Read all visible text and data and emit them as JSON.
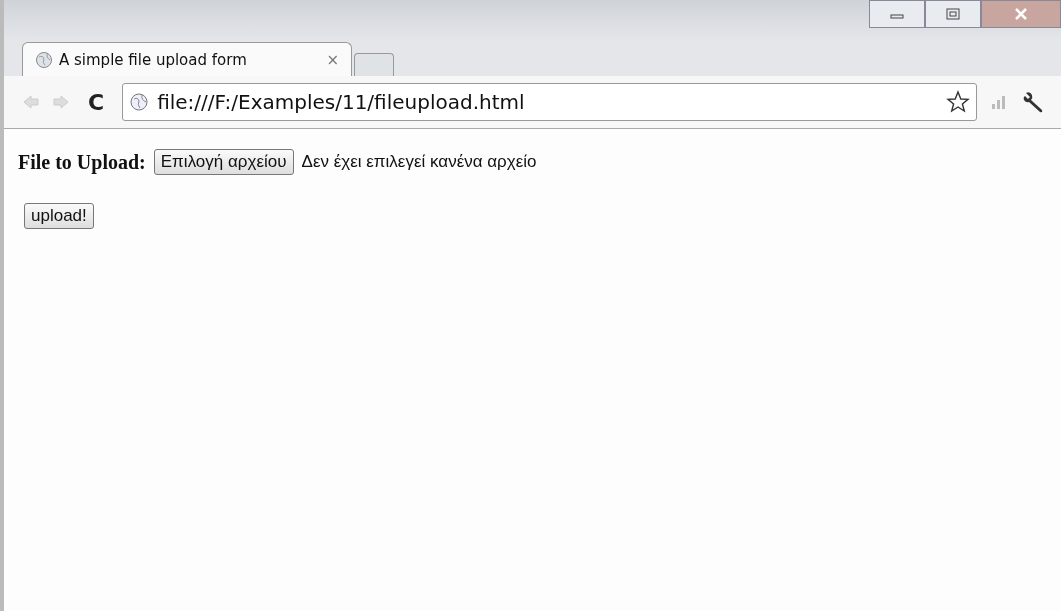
{
  "tabs": [
    {
      "label": "A simple file upload form",
      "close": "×",
      "selected": true
    }
  ],
  "toolbar": {
    "reload": "C",
    "address": "file:///F:/Examples/11/fileupload.html"
  },
  "form": {
    "label": "File to Upload:",
    "file_button": "Επιλογή αρχείου",
    "file_status": "Δεν έχει επιλεγεί κανένα αρχείο",
    "submit": "upload!"
  }
}
